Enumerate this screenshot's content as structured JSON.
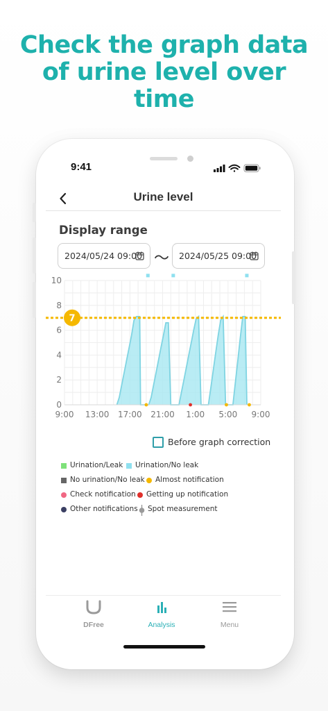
{
  "headline": {
    "line1": "Check the graph data",
    "line2": "of urine level over",
    "line3": "time"
  },
  "status_bar": {
    "time": "9:41"
  },
  "nav": {
    "title": "Urine level"
  },
  "display_range": {
    "label": "Display range",
    "start": "2024/05/24 09:00",
    "separator": "〜",
    "end": "2024/05/25 09:00"
  },
  "chart_data": {
    "type": "area",
    "y_ticks": [
      "10",
      "8",
      "6",
      "4",
      "2",
      "0"
    ],
    "x_ticks": [
      "9:00",
      "13:00",
      "17:00",
      "21:00",
      "1:00",
      "5:00",
      "9:00"
    ],
    "ylim": [
      0,
      10
    ],
    "x_range_hours": [
      9,
      33
    ],
    "grid": true,
    "threshold": {
      "value": 7,
      "label": "7",
      "color": "#f5b800"
    },
    "area_color": "#a7e7f1",
    "line_color": "#7fd4e2",
    "series": [
      {
        "points": [
          [
            15.4,
            0
          ],
          [
            15.7,
            0.6
          ],
          [
            16.0,
            1.6
          ],
          [
            16.3,
            2.6
          ],
          [
            16.6,
            3.6
          ],
          [
            16.9,
            4.6
          ],
          [
            17.2,
            5.6
          ],
          [
            17.5,
            6.8
          ],
          [
            17.8,
            7.1
          ],
          [
            18.2,
            7.1
          ],
          [
            18.3,
            0
          ],
          [
            19.3,
            0
          ],
          [
            19.6,
            0.6
          ],
          [
            19.9,
            1.6
          ],
          [
            20.2,
            2.6
          ],
          [
            20.5,
            3.6
          ],
          [
            20.8,
            4.6
          ],
          [
            21.1,
            5.6
          ],
          [
            21.4,
            6.6
          ],
          [
            21.7,
            6.6
          ],
          [
            22.0,
            0
          ],
          [
            23.0,
            0
          ],
          [
            23.3,
            1.0
          ],
          [
            23.6,
            2.0
          ],
          [
            23.9,
            3.0
          ],
          [
            24.2,
            4.0
          ],
          [
            24.5,
            5.0
          ],
          [
            24.8,
            6.0
          ],
          [
            25.1,
            6.9
          ],
          [
            25.4,
            7.1
          ],
          [
            25.7,
            0
          ],
          [
            26.6,
            0
          ],
          [
            26.9,
            1.4
          ],
          [
            27.2,
            2.8
          ],
          [
            27.5,
            4.2
          ],
          [
            27.8,
            5.6
          ],
          [
            28.1,
            6.8
          ],
          [
            28.4,
            7.1
          ],
          [
            28.7,
            0
          ],
          [
            29.6,
            0
          ],
          [
            29.9,
            1.8
          ],
          [
            30.2,
            3.6
          ],
          [
            30.5,
            5.4
          ],
          [
            30.8,
            7.1
          ],
          [
            31.1,
            7.1
          ],
          [
            31.3,
            0
          ]
        ]
      }
    ],
    "markers": [
      {
        "x": 19.2,
        "y": 10.4,
        "kind": "urination-no-leak"
      },
      {
        "x": 22.3,
        "y": 10.4,
        "kind": "urination-no-leak"
      },
      {
        "x": 31.3,
        "y": 10.4,
        "kind": "urination-no-leak"
      },
      {
        "x": 19.0,
        "y": 0,
        "kind": "almost-notification"
      },
      {
        "x": 24.4,
        "y": 0,
        "kind": "getting-up-notification"
      },
      {
        "x": 28.8,
        "y": 0,
        "kind": "almost-notification"
      },
      {
        "x": 31.6,
        "y": 0,
        "kind": "almost-notification"
      }
    ]
  },
  "before_correction": {
    "label": "Before graph correction",
    "color": "#2f9ea9"
  },
  "legend": [
    {
      "label": "Urination/Leak",
      "color": "#7ee17a",
      "shape": "square"
    },
    {
      "label": "Urination/No leak",
      "color": "#8fe0ef",
      "shape": "square"
    },
    {
      "label": "No urination/No leak",
      "color": "#666666",
      "shape": "square"
    },
    {
      "label": "Almost notification",
      "color": "#f5b800",
      "shape": "dot"
    },
    {
      "label": "Check notification",
      "color": "#f06783",
      "shape": "dot"
    },
    {
      "label": "Getting up notification",
      "color": "#e0302b",
      "shape": "dot"
    },
    {
      "label": "Other notifications",
      "color": "#3b3f63",
      "shape": "dot"
    },
    {
      "label": "Spot measurement",
      "color": "#9a9a9a",
      "shape": "spot"
    }
  ],
  "tabs": [
    {
      "label": "DFree",
      "icon": "dfree-device-icon",
      "active": false
    },
    {
      "label": "Analysis",
      "icon": "bar-chart-icon",
      "active": true
    },
    {
      "label": "Menu",
      "icon": "hamburger-menu-icon",
      "active": false
    }
  ],
  "colors": {
    "accent": "#1eb1ac",
    "active_tab": "#2bb0b6",
    "inactive_tab": "#9a9a9a"
  }
}
